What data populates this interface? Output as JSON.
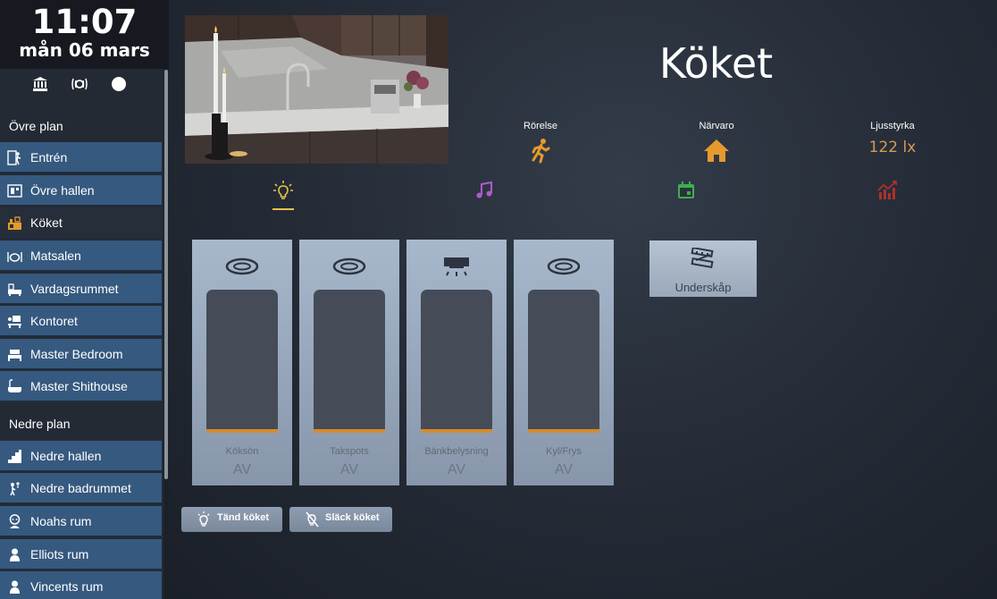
{
  "clock": {
    "time": "11:07",
    "date": "mån 06 mars"
  },
  "quick_icons": [
    "bank-icon",
    "alarm-icon",
    "compass-icon"
  ],
  "sidebar": {
    "sections": [
      {
        "title": "Övre plan",
        "items": [
          {
            "label": "Entrén",
            "icon": "entrance-icon"
          },
          {
            "label": "Övre hallen",
            "icon": "hallway-icon"
          },
          {
            "label": "Köket",
            "icon": "kitchen-icon",
            "active": true
          },
          {
            "label": "Matsalen",
            "icon": "dining-icon"
          },
          {
            "label": "Vardagsrummet",
            "icon": "sofa-icon"
          },
          {
            "label": "Kontoret",
            "icon": "office-icon"
          },
          {
            "label": "Master Bedroom",
            "icon": "bed-icon"
          },
          {
            "label": "Master Shithouse",
            "icon": "bathtub-icon"
          }
        ]
      },
      {
        "title": "Nedre plan",
        "items": [
          {
            "label": "Nedre hallen",
            "icon": "stairs-icon"
          },
          {
            "label": "Nedre badrummet",
            "icon": "shower-icon"
          },
          {
            "label": "Noahs rum",
            "icon": "child-icon"
          },
          {
            "label": "Elliots rum",
            "icon": "child-icon"
          },
          {
            "label": "Vincents rum",
            "icon": "child-icon"
          }
        ]
      }
    ]
  },
  "room": {
    "title": "Köket"
  },
  "stats": {
    "motion": {
      "label": "Rörelse",
      "icon": "running-person-icon"
    },
    "presence": {
      "label": "Närvaro",
      "icon": "home-icon"
    },
    "light": {
      "label": "Ljusstyrka",
      "value": "122 lx"
    }
  },
  "tabs": [
    {
      "icon": "lightbulb-icon",
      "color": "#e7c14a",
      "active": true
    },
    {
      "icon": "music-note-icon",
      "color": "#b15cc9"
    },
    {
      "icon": "calendar-icon",
      "color": "#3fae4c"
    },
    {
      "icon": "chart-icon",
      "color": "#b0302a"
    }
  ],
  "lights": [
    {
      "name": "Köksön",
      "state": "AV",
      "icon": "ceiling-lamp-icon",
      "level": 0
    },
    {
      "name": "Takspots",
      "state": "AV",
      "icon": "ceiling-lamp-icon",
      "level": 0
    },
    {
      "name": "Bänkbelysning",
      "state": "AV",
      "icon": "under-cabinet-light-icon",
      "level": 0
    },
    {
      "name": "Kyl/Frys",
      "state": "AV",
      "icon": "ceiling-lamp-icon",
      "level": 0
    }
  ],
  "switches": [
    {
      "label": "Underskåp",
      "icon": "led-strip-icon"
    }
  ],
  "actions": {
    "turn_on": {
      "label": "Tänd köket",
      "icon": "bulb-on-icon"
    },
    "turn_off": {
      "label": "Släck köket",
      "icon": "bulb-off-icon"
    }
  },
  "colors": {
    "accent": "#d59a55",
    "slider_fill": "#d88b2a",
    "nav_bg": "#36597f"
  }
}
